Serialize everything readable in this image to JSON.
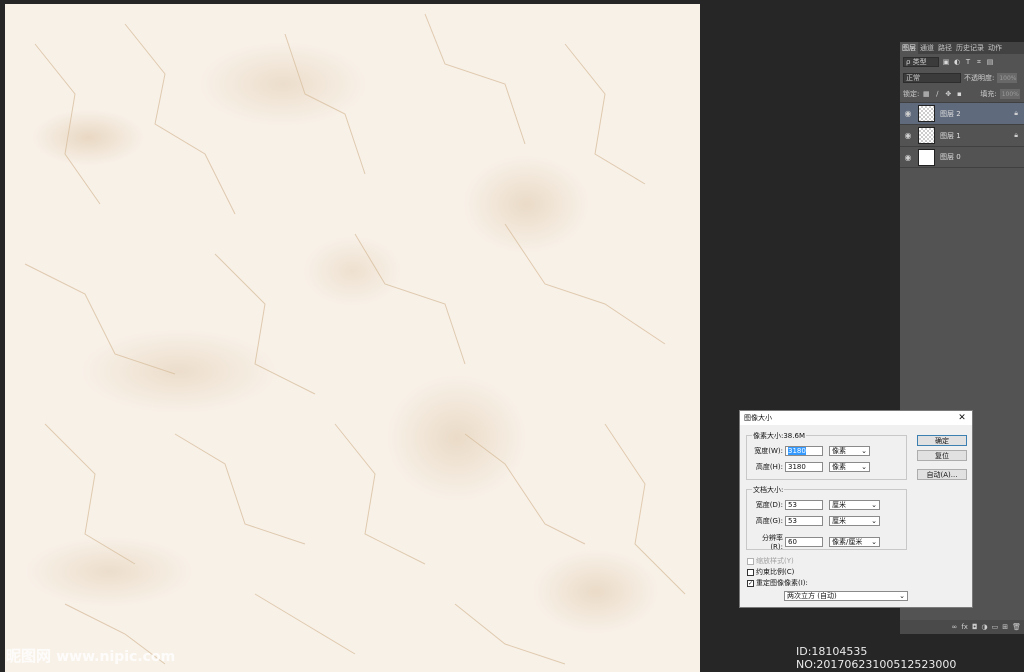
{
  "layers_panel": {
    "tabs": [
      "图层",
      "通道",
      "路径",
      "历史记录",
      "动作"
    ],
    "filter_label": "ρ 类型",
    "blend_mode": "正常",
    "opacity_label": "不透明度:",
    "opacity_value": "100%",
    "lock_label": "锁定:",
    "fill_label": "填充:",
    "fill_value": "100%",
    "layers": [
      {
        "name": "图层 2",
        "selected": true,
        "thumb": "checker",
        "locked": true
      },
      {
        "name": "图层 1",
        "selected": false,
        "thumb": "checker",
        "locked": true
      },
      {
        "name": "图层 0",
        "selected": false,
        "thumb": "white",
        "locked": false
      }
    ],
    "bottom_icons": [
      "link-icon",
      "fx-icon",
      "mask-icon",
      "adjustment-icon",
      "group-icon",
      "new-layer-icon",
      "trash-icon"
    ]
  },
  "dialog": {
    "title": "图像大小",
    "pixel_group_label": "像素大小:38.6M",
    "pixel_width_label": "宽度(W):",
    "pixel_width_value": "3180",
    "pixel_width_unit": "像素",
    "pixel_height_label": "高度(H):",
    "pixel_height_value": "3180",
    "pixel_height_unit": "像素",
    "doc_group_label": "文档大小:",
    "doc_width_label": "宽度(D):",
    "doc_width_value": "53",
    "doc_width_unit": "厘米",
    "doc_height_label": "高度(G):",
    "doc_height_value": "53",
    "doc_height_unit": "厘米",
    "resolution_label": "分辨率(R):",
    "resolution_value": "60",
    "resolution_unit": "像素/厘米",
    "ok_label": "确定",
    "reset_label": "复位",
    "auto_label": "自动(A)...",
    "scale_styles_label": "缩放样式(Y)",
    "constrain_label": "约束比例(C)",
    "resample_label": "重定图像像素(I):",
    "resample_method": "两次立方 (自动)"
  },
  "watermark": {
    "brand": "昵图网",
    "url": "www.nipic.com",
    "id_text": "ID:18104535 NO:20170623100512523000"
  }
}
